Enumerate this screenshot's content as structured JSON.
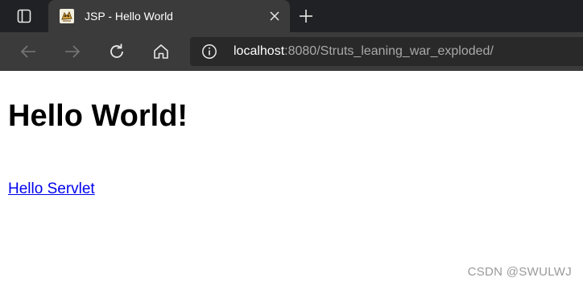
{
  "browser": {
    "tab": {
      "title": "JSP - Hello World",
      "favicon": "tomcat-icon"
    },
    "address_bar": {
      "host": "localhost",
      "rest": ":8080/Struts_leaning_war_exploded/"
    },
    "icons": {
      "tab_actions": "tab-actions-icon",
      "close": "close-icon",
      "new_tab": "plus-icon",
      "back": "back-arrow-icon",
      "forward": "forward-arrow-icon",
      "reload": "reload-icon",
      "home": "home-icon",
      "site_info": "info-icon"
    },
    "colors": {
      "tabstrip": "#202124",
      "toolbar": "#3b3b3b",
      "omnibox": "#292929"
    }
  },
  "page": {
    "heading": "Hello World!",
    "link": "Hello Servlet",
    "link_color": "#0000ee"
  },
  "watermark": "CSDN @SWULWJ"
}
